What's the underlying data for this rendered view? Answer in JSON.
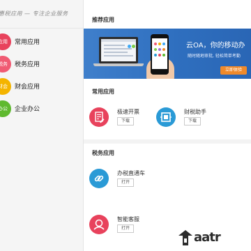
{
  "brand": {
    "title": "惠税应用 — 专注企业服务"
  },
  "sidebar": {
    "items": [
      {
        "label": "常用应用",
        "icon_text": "应用",
        "icon_color": "#e8425c"
      },
      {
        "label": "税务应用",
        "icon_text": "税务",
        "icon_color": "#f05b73"
      },
      {
        "label": "财会应用",
        "icon_text": "财会",
        "icon_color": "#f4b400"
      },
      {
        "label": "企业办公",
        "icon_text": "办公",
        "icon_color": "#5fb92f"
      }
    ]
  },
  "main": {
    "recommended": {
      "title": "推荐应用"
    },
    "banner": {
      "title": "云OA，你的移动办",
      "subtitle": "随时随地审批, 轻松简单考勤",
      "button": "立即体验"
    },
    "common": {
      "title": "常用应用",
      "apps": [
        {
          "name": "极速开票",
          "button": "下载",
          "icon": "invoice-icon",
          "color": "#e8425c"
        },
        {
          "name": "财税助手",
          "button": "下载",
          "icon": "tax-assistant-icon",
          "color": "#2a9ad6"
        }
      ]
    },
    "tax": {
      "title": "税务应用",
      "apps": [
        {
          "name": "办税直通车",
          "button": "打开",
          "icon": "link-icon",
          "color": "#2a9ad6"
        },
        {
          "name": "智能客服",
          "button": "打开",
          "icon": "customer-service-icon",
          "color": "#e8425c"
        }
      ]
    }
  },
  "watermark": {
    "text": "aatr"
  }
}
